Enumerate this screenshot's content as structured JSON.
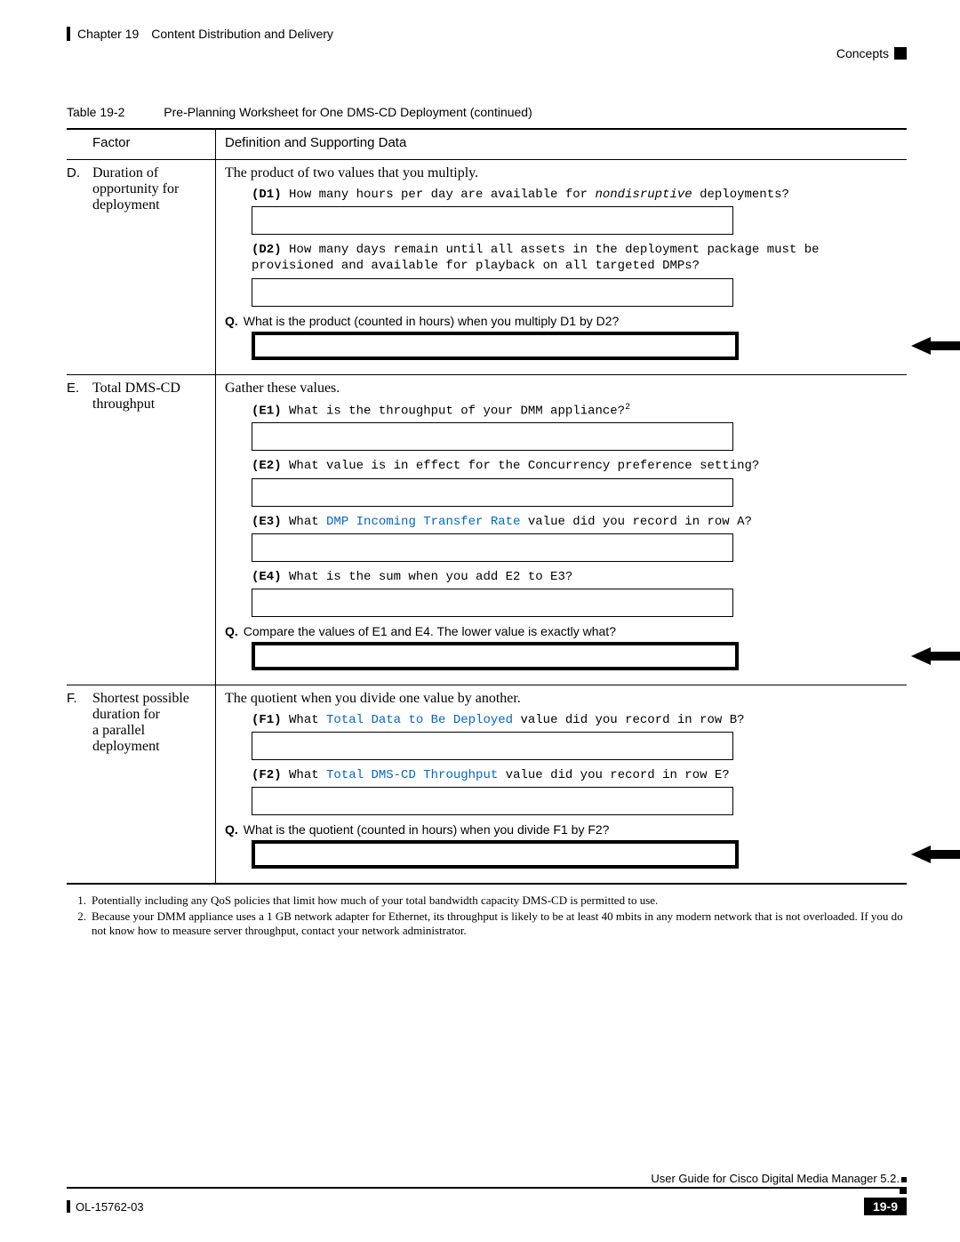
{
  "header": {
    "chapter": "Chapter 19",
    "title": "Content Distribution and Delivery",
    "right": "Concepts"
  },
  "table": {
    "label": "Table 19-2",
    "caption": "Pre-Planning Worksheet for One DMS-CD Deployment (continued)",
    "col_factor": "Factor",
    "col_def": "Definition and Supporting Data"
  },
  "rows": {
    "D": {
      "letter": "D.",
      "factor": "Duration of opportunity for deployment",
      "intro": "The product of two values that you multiply.",
      "d1_tag": "(D1)",
      "d1_pre": " How many hours per day are available for ",
      "d1_ital": "nondisruptive",
      "d1_post": " deployments?",
      "d2_tag": "(D2)",
      "d2_text": " How many days remain until all assets in the deployment package must be provisioned and available for playback on all targeted DMPs?",
      "q_label": "Q.",
      "q_text": "What is the product (counted in hours) when you multiply D1 by D2?"
    },
    "E": {
      "letter": "E.",
      "factor": "Total DMS-CD throughput",
      "intro": "Gather these values.",
      "e1_tag": "(E1)",
      "e1_text": " What is the throughput of your DMM appliance?",
      "e1_sup": "2",
      "e2_tag": "(E2)",
      "e2_text": " What value is in effect for the Concurrency preference setting?",
      "e3_tag": "(E3)",
      "e3_pre": " What ",
      "e3_link": "DMP Incoming Transfer Rate",
      "e3_post": " value did you record in row A?",
      "e4_tag": "(E4)",
      "e4_text": " What is the sum when you add E2 to E3?",
      "q_label": "Q.",
      "q_text": "Compare the values of E1 and E4. The lower value is exactly what?"
    },
    "F": {
      "letter": "F.",
      "factor": "Shortest possible duration for a parallel deployment",
      "intro": "The quotient when you divide one value by another.",
      "f1_tag": "(F1)",
      "f1_pre": " What ",
      "f1_link": "Total Data to Be Deployed",
      "f1_post": " value did you record in row B?",
      "f2_tag": "(F2)",
      "f2_pre": " What ",
      "f2_link": "Total DMS-CD Throughput",
      "f2_post": " value did you record in row E?",
      "q_label": "Q.",
      "q_text": "What is the quotient (counted in hours) when you divide F1 by F2?"
    }
  },
  "footnotes": {
    "n1": "1.",
    "t1": "Potentially including any QoS policies that limit how much of your total bandwidth capacity DMS-CD is permitted to use.",
    "n2": "2.",
    "t2": "Because your DMM appliance uses a 1 GB network adapter for Ethernet, its throughput is likely to be at least 40 mbits in any modern network that is not overloaded. If you do not know how to measure server throughput, contact your network administrator."
  },
  "footer": {
    "guide": "User Guide for Cisco Digital Media Manager 5.2.",
    "doc": "OL-15762-03",
    "page": "19-9"
  }
}
